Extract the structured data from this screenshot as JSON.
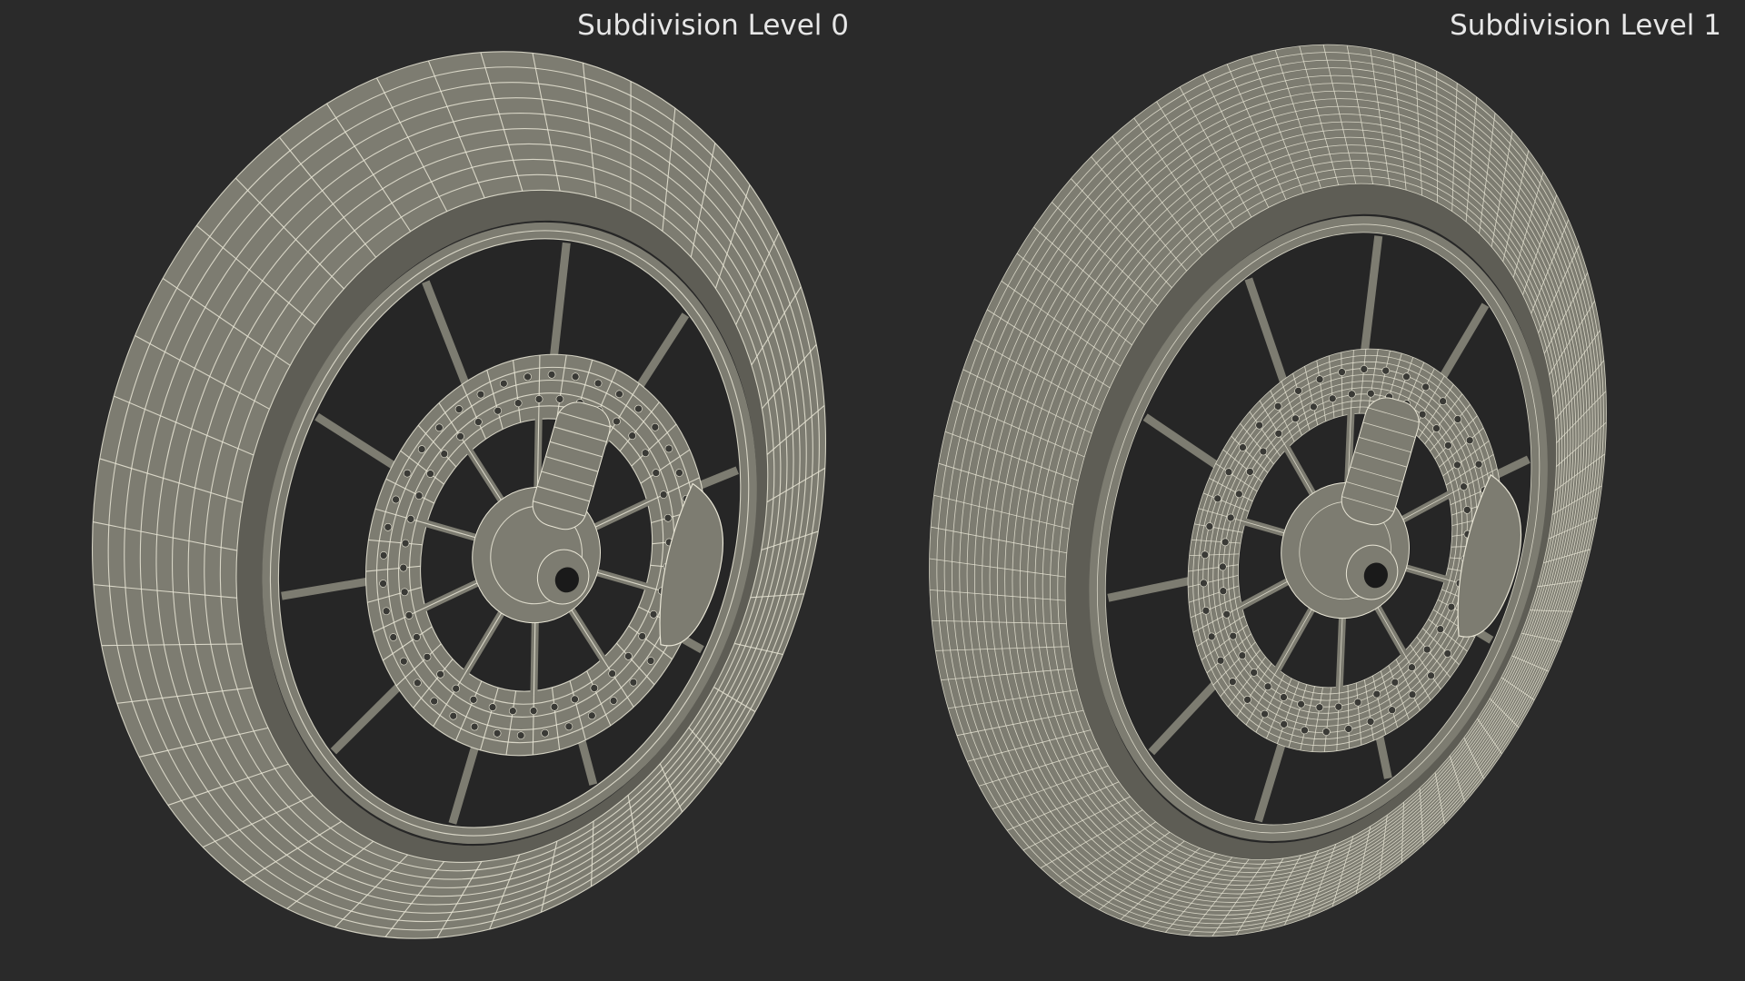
{
  "views": [
    {
      "label": "Subdivision Level 0",
      "tire_segments": 44,
      "tire_rings": 9,
      "disc_rings": 5,
      "disc_segments": 40
    },
    {
      "label": "Subdivision Level 1",
      "tire_segments": 88,
      "tire_rings": 18,
      "disc_rings": 10,
      "disc_segments": 80
    }
  ],
  "colors": {
    "background": "#2a2a2a",
    "surface": "#7d7c71",
    "surface_shade": "#5e5d55",
    "wire": "#e9e6d6"
  }
}
